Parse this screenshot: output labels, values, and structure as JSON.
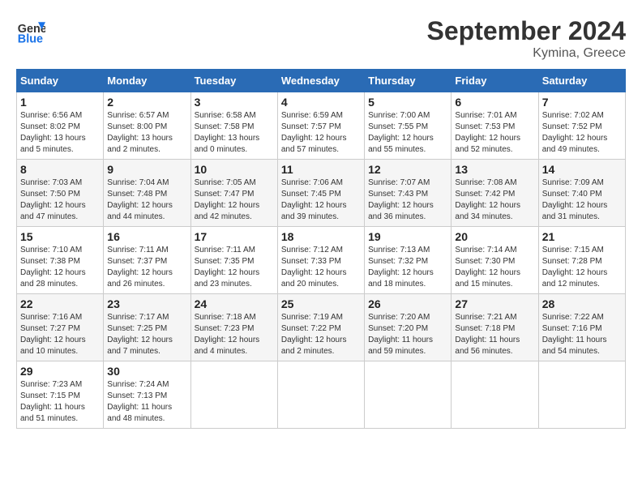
{
  "header": {
    "logo_line1": "General",
    "logo_line2": "Blue",
    "month_title": "September 2024",
    "subtitle": "Kymina, Greece"
  },
  "days_of_week": [
    "Sunday",
    "Monday",
    "Tuesday",
    "Wednesday",
    "Thursday",
    "Friday",
    "Saturday"
  ],
  "weeks": [
    [
      {
        "day": "1",
        "sunrise": "6:56 AM",
        "sunset": "8:02 PM",
        "daylight": "13 hours and 5 minutes."
      },
      {
        "day": "2",
        "sunrise": "6:57 AM",
        "sunset": "8:00 PM",
        "daylight": "13 hours and 2 minutes."
      },
      {
        "day": "3",
        "sunrise": "6:58 AM",
        "sunset": "7:58 PM",
        "daylight": "13 hours and 0 minutes."
      },
      {
        "day": "4",
        "sunrise": "6:59 AM",
        "sunset": "7:57 PM",
        "daylight": "12 hours and 57 minutes."
      },
      {
        "day": "5",
        "sunrise": "7:00 AM",
        "sunset": "7:55 PM",
        "daylight": "12 hours and 55 minutes."
      },
      {
        "day": "6",
        "sunrise": "7:01 AM",
        "sunset": "7:53 PM",
        "daylight": "12 hours and 52 minutes."
      },
      {
        "day": "7",
        "sunrise": "7:02 AM",
        "sunset": "7:52 PM",
        "daylight": "12 hours and 49 minutes."
      }
    ],
    [
      {
        "day": "8",
        "sunrise": "7:03 AM",
        "sunset": "7:50 PM",
        "daylight": "12 hours and 47 minutes."
      },
      {
        "day": "9",
        "sunrise": "7:04 AM",
        "sunset": "7:48 PM",
        "daylight": "12 hours and 44 minutes."
      },
      {
        "day": "10",
        "sunrise": "7:05 AM",
        "sunset": "7:47 PM",
        "daylight": "12 hours and 42 minutes."
      },
      {
        "day": "11",
        "sunrise": "7:06 AM",
        "sunset": "7:45 PM",
        "daylight": "12 hours and 39 minutes."
      },
      {
        "day": "12",
        "sunrise": "7:07 AM",
        "sunset": "7:43 PM",
        "daylight": "12 hours and 36 minutes."
      },
      {
        "day": "13",
        "sunrise": "7:08 AM",
        "sunset": "7:42 PM",
        "daylight": "12 hours and 34 minutes."
      },
      {
        "day": "14",
        "sunrise": "7:09 AM",
        "sunset": "7:40 PM",
        "daylight": "12 hours and 31 minutes."
      }
    ],
    [
      {
        "day": "15",
        "sunrise": "7:10 AM",
        "sunset": "7:38 PM",
        "daylight": "12 hours and 28 minutes."
      },
      {
        "day": "16",
        "sunrise": "7:11 AM",
        "sunset": "7:37 PM",
        "daylight": "12 hours and 26 minutes."
      },
      {
        "day": "17",
        "sunrise": "7:11 AM",
        "sunset": "7:35 PM",
        "daylight": "12 hours and 23 minutes."
      },
      {
        "day": "18",
        "sunrise": "7:12 AM",
        "sunset": "7:33 PM",
        "daylight": "12 hours and 20 minutes."
      },
      {
        "day": "19",
        "sunrise": "7:13 AM",
        "sunset": "7:32 PM",
        "daylight": "12 hours and 18 minutes."
      },
      {
        "day": "20",
        "sunrise": "7:14 AM",
        "sunset": "7:30 PM",
        "daylight": "12 hours and 15 minutes."
      },
      {
        "day": "21",
        "sunrise": "7:15 AM",
        "sunset": "7:28 PM",
        "daylight": "12 hours and 12 minutes."
      }
    ],
    [
      {
        "day": "22",
        "sunrise": "7:16 AM",
        "sunset": "7:27 PM",
        "daylight": "12 hours and 10 minutes."
      },
      {
        "day": "23",
        "sunrise": "7:17 AM",
        "sunset": "7:25 PM",
        "daylight": "12 hours and 7 minutes."
      },
      {
        "day": "24",
        "sunrise": "7:18 AM",
        "sunset": "7:23 PM",
        "daylight": "12 hours and 4 minutes."
      },
      {
        "day": "25",
        "sunrise": "7:19 AM",
        "sunset": "7:22 PM",
        "daylight": "12 hours and 2 minutes."
      },
      {
        "day": "26",
        "sunrise": "7:20 AM",
        "sunset": "7:20 PM",
        "daylight": "11 hours and 59 minutes."
      },
      {
        "day": "27",
        "sunrise": "7:21 AM",
        "sunset": "7:18 PM",
        "daylight": "11 hours and 56 minutes."
      },
      {
        "day": "28",
        "sunrise": "7:22 AM",
        "sunset": "7:16 PM",
        "daylight": "11 hours and 54 minutes."
      }
    ],
    [
      {
        "day": "29",
        "sunrise": "7:23 AM",
        "sunset": "7:15 PM",
        "daylight": "11 hours and 51 minutes."
      },
      {
        "day": "30",
        "sunrise": "7:24 AM",
        "sunset": "7:13 PM",
        "daylight": "11 hours and 48 minutes."
      },
      null,
      null,
      null,
      null,
      null
    ]
  ]
}
